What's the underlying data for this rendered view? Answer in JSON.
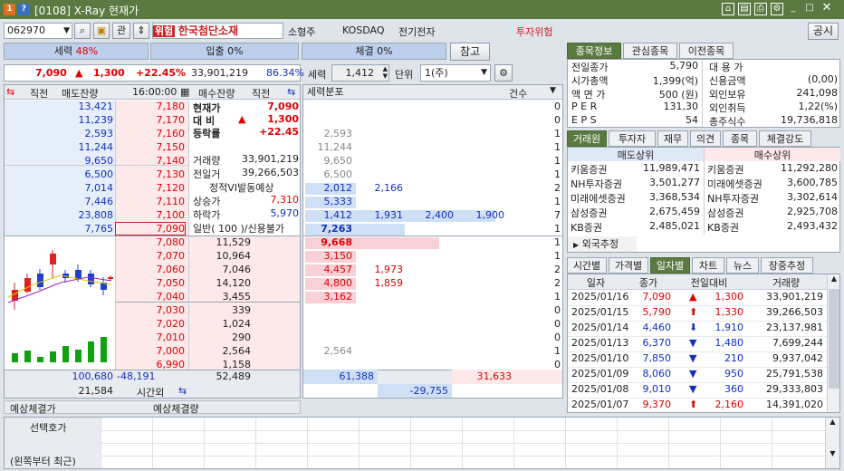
{
  "title": {
    "badge_a": "1",
    "badge_b": "?",
    "text": "[0108] X-Ray 현재가"
  },
  "topbar": {
    "code": "062970",
    "gwan": "관",
    "risk_tag": "위험",
    "name": "한국첨단소재",
    "size": "소형주",
    "market": "KOSDAQ",
    "sector": "전기전자",
    "warning": "투자위험",
    "notice": "공시"
  },
  "strength": {
    "label": "세력",
    "value": "48%",
    "inflow_label": "입출",
    "inflow": "0%",
    "fill_label": "체결",
    "fill": "0%",
    "ref_button": "참고"
  },
  "price_line": {
    "price": "7,090",
    "arrow": "▲",
    "change": "1,300",
    "rate": "+22.45%",
    "volume": "33,901,219",
    "ratio": "86.34%"
  },
  "controls": {
    "seryeok_label": "세력",
    "seryeok_val": "1,412",
    "unit_label": "단위",
    "unit_val": "1(주)"
  },
  "orderbook": {
    "hdr": {
      "left_arrow": "⇆",
      "jikjeon_l": "직전",
      "sell_rem": "매도잔량",
      "time": "16:00:00",
      "buy_rem": "매수잔량",
      "jikjeon_r": "직전",
      "right_arrow": "⇆"
    },
    "asks": [
      {
        "qty": "13,421",
        "price": "7,180"
      },
      {
        "qty": "11,239",
        "price": "7,170"
      },
      {
        "qty": "2,593",
        "price": "7,160"
      },
      {
        "qty": "11,244",
        "price": "7,150"
      },
      {
        "qty": "9,650",
        "price": "7,140"
      },
      {
        "qty": "6,500",
        "price": "7,130"
      },
      {
        "qty": "7,014",
        "price": "7,120"
      },
      {
        "qty": "7,446",
        "price": "7,110"
      },
      {
        "qty": "23,808",
        "price": "7,100"
      },
      {
        "qty": "7,765",
        "price": "7,090"
      }
    ],
    "bids": [
      {
        "price": "7,080",
        "qty": "11,529"
      },
      {
        "price": "7,070",
        "qty": "10,964"
      },
      {
        "price": "7,060",
        "qty": "7,046"
      },
      {
        "price": "7,050",
        "qty": "14,120"
      },
      {
        "price": "7,040",
        "qty": "3,455"
      },
      {
        "price": "7,030",
        "qty": "339"
      },
      {
        "price": "7,020",
        "qty": "1,024"
      },
      {
        "price": "7,010",
        "qty": "290"
      },
      {
        "price": "7,000",
        "qty": "2,564"
      },
      {
        "price": "6,990",
        "qty": "1,158"
      }
    ],
    "info": [
      {
        "label": "현재가",
        "value": "7,090"
      },
      {
        "label": "대 비",
        "arrow": "▲",
        "value": "1,300"
      },
      {
        "label": "등락률",
        "value": "+22.45"
      },
      {
        "label": "거래량",
        "value": "33,901,219"
      },
      {
        "label": "전일거",
        "value": "39,266,503"
      },
      {
        "label": "정적VI발동예상",
        "value": ""
      },
      {
        "label": "상승가",
        "value": "7,310"
      },
      {
        "label": "하락가",
        "value": "5,970"
      },
      {
        "label": "일반( 100 )/신용불가",
        "value": ""
      }
    ],
    "totals": {
      "sell": "100,680",
      "diff": "-48,191",
      "buy": "52,489",
      "after_sell": "21,584",
      "after_label": "시간외"
    },
    "expect": {
      "fill_label": "예상체결가",
      "qty_label": "예상체결량"
    }
  },
  "power": {
    "hdr": {
      "label": "세력분포",
      "count": "건수"
    },
    "ask_rows": [
      {
        "v": "",
        "c": "0"
      },
      {
        "v": "",
        "c": "0"
      },
      {
        "v": "2,593",
        "c": "1"
      },
      {
        "v": "11,244",
        "c": "1"
      },
      {
        "v": "9,650",
        "c": "1"
      },
      {
        "v": "6,500",
        "c": "1"
      },
      {
        "v": "2,012",
        "v2": "2,166",
        "c": "2"
      },
      {
        "v": "5,333",
        "c": "1"
      },
      {
        "v": "1,412",
        "v2": "1,931",
        "v3": "2,400",
        "v4": "1,900",
        "c": "7"
      },
      {
        "v": "7,263",
        "c": "1"
      }
    ],
    "bid_rows": [
      {
        "v": "9,668",
        "c": "1"
      },
      {
        "v": "3,150",
        "c": "1"
      },
      {
        "v": "4,457",
        "v2": "1,973",
        "c": "2"
      },
      {
        "v": "4,800",
        "v2": "1,859",
        "c": "2"
      },
      {
        "v": "3,162",
        "c": "1"
      },
      {
        "v": "",
        "c": "0"
      },
      {
        "v": "",
        "c": "0"
      },
      {
        "v": "",
        "c": "0"
      },
      {
        "v": "2,564",
        "c": "1"
      },
      {
        "v": "",
        "c": "0"
      }
    ],
    "totals": {
      "buy": "61,388",
      "sell": "31,633",
      "net": "-29,755"
    }
  },
  "stockinfo": {
    "tabs": [
      "종목정보",
      "관심종목",
      "이전종목"
    ],
    "rows": [
      {
        "l": "전일종가",
        "v": "5,790",
        "l2": "대 용 가",
        "v2": ""
      },
      {
        "l": "시가총액",
        "v": "1,399(억)",
        "l2": "신용금액",
        "v2": "(0,00)"
      },
      {
        "l": "액 면 가",
        "v": "500 (원)",
        "l2": "외인보유",
        "v2": "241,098"
      },
      {
        "l": "P E R",
        "v": "131,30",
        "l2": "외인취득",
        "v2": "1,22(%)"
      },
      {
        "l": "E P S",
        "v": "54",
        "l2": "총주식수",
        "v2": "19,736,818"
      }
    ]
  },
  "brokers": {
    "tabs": [
      "거래원",
      "투자자",
      "재무",
      "의견",
      "종목",
      "체결강도"
    ],
    "sell_hdr": "매도상위",
    "buy_hdr": "매수상위",
    "rows": [
      {
        "s": "키움증권",
        "sv": "11,989,471",
        "b": "키움증권",
        "bv": "11,292,280"
      },
      {
        "s": "NH투자증권",
        "sv": "3,501,277",
        "b": "미래에셋증권",
        "bv": "3,600,785"
      },
      {
        "s": "미래에셋증권",
        "sv": "3,368,534",
        "b": "NH투자증권",
        "bv": "3,302,614"
      },
      {
        "s": "삼성증권",
        "sv": "2,675,459",
        "b": "삼성증권",
        "bv": "2,925,708"
      },
      {
        "s": "KB증권",
        "sv": "2,485,021",
        "b": "KB증권",
        "bv": "2,493,432"
      }
    ],
    "foreign": "외국추정"
  },
  "daily": {
    "tabs": [
      "시간별",
      "가격별",
      "일자별",
      "차트",
      "뉴스",
      "장중추정"
    ],
    "headers": [
      "일자",
      "종가",
      "전일대비",
      "거래량"
    ],
    "rows": [
      {
        "date": "2025/01/16",
        "close": "7,090",
        "arrow": "▲",
        "diff": "1,300",
        "vol": "33,901,219",
        "up": true
      },
      {
        "date": "2025/01/15",
        "close": "5,790",
        "arrow": "⬆",
        "diff": "1,330",
        "vol": "39,266,503",
        "up": true
      },
      {
        "date": "2025/01/14",
        "close": "4,460",
        "arrow": "⬇",
        "diff": "1,910",
        "vol": "23,137,981",
        "up": false
      },
      {
        "date": "2025/01/13",
        "close": "6,370",
        "arrow": "▼",
        "diff": "1,480",
        "vol": "7,699,244",
        "up": false
      },
      {
        "date": "2025/01/10",
        "close": "7,850",
        "arrow": "▼",
        "diff": "210",
        "vol": "9,937,042",
        "up": false
      },
      {
        "date": "2025/01/09",
        "close": "8,060",
        "arrow": "▼",
        "diff": "950",
        "vol": "25,791,538",
        "up": false
      },
      {
        "date": "2025/01/08",
        "close": "9,010",
        "arrow": "▼",
        "diff": "360",
        "vol": "29,333,803",
        "up": false
      },
      {
        "date": "2025/01/07",
        "close": "9,370",
        "arrow": "⬆",
        "diff": "2,160",
        "vol": "14,391,020",
        "up": true
      }
    ]
  },
  "bottom": {
    "label1": "선택호가",
    "label2": "(왼쪽부터 최근)"
  },
  "colors": {
    "up": "#e00000",
    "down": "#1030c0",
    "titlebar": "#5a7a42",
    "ask_bg": "#e6eef9",
    "bid_bg": "#fde8ea"
  }
}
